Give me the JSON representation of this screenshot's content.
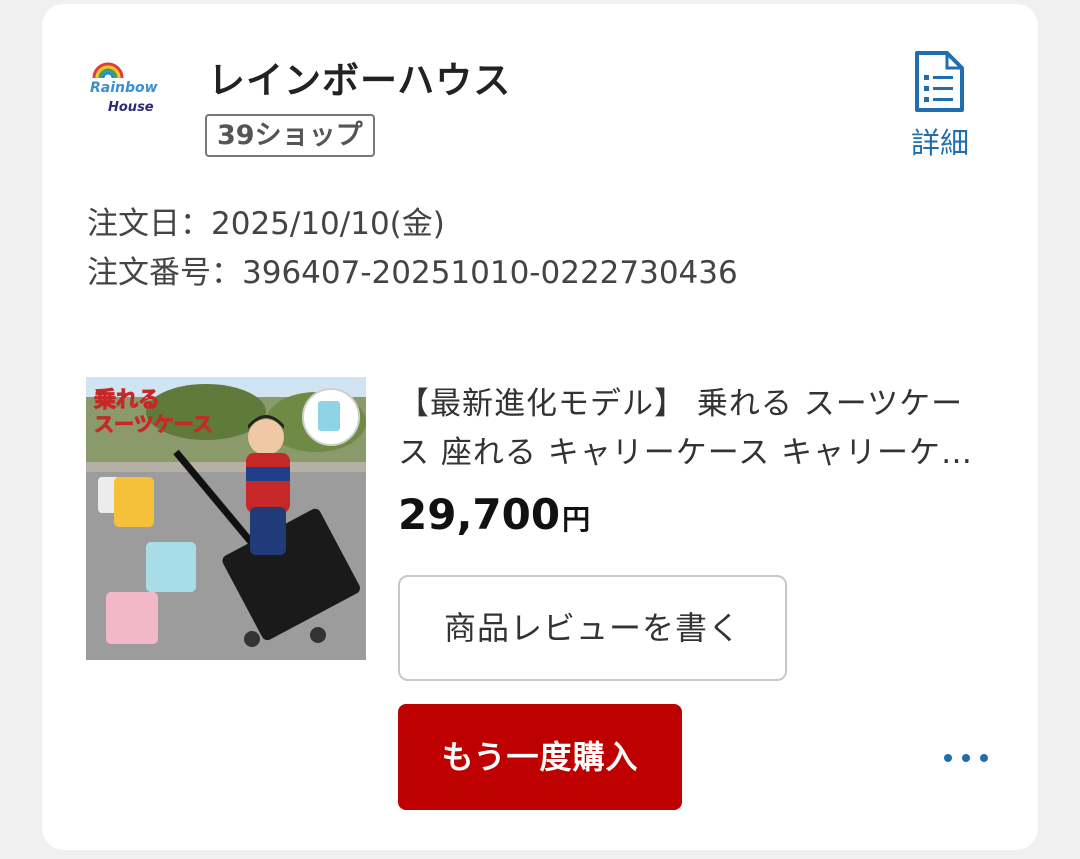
{
  "shop": {
    "logo_line1": "Rainbow",
    "logo_line2": "House",
    "name": "レインボーハウス",
    "badge": "39ショップ"
  },
  "detail": {
    "icon": "document-list-icon",
    "label": "詳細"
  },
  "order": {
    "date": "注文日：2025/10/10(金)",
    "number": "注文番号：396407-20251010-0222730436"
  },
  "product": {
    "image_text_top": "乗れる",
    "image_text_bottom": "スーツケース",
    "title": "【最新進化モデル】 乗れる スーツケース 座れる キャリーケース キャリーケース キャリーバッグ",
    "price_amount": "29,700",
    "price_unit": "円"
  },
  "actions": {
    "review_label": "商品レビューを書く",
    "rebuy_label": "もう一度購入",
    "more_icon": "more-dots-icon"
  },
  "colors": {
    "accent_blue": "#1f6fb0",
    "rebuy_red": "#bf0000"
  }
}
